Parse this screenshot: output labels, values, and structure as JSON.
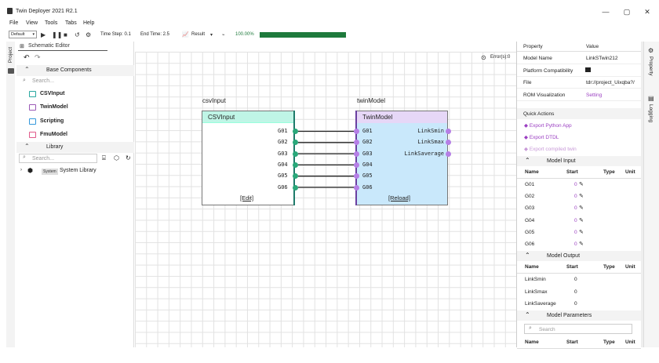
{
  "window": {
    "title": "Twin Deployer 2021 R2.1",
    "minimize": "—",
    "maximize": "▢",
    "close": "✕"
  },
  "menu": [
    "File",
    "View",
    "Tools",
    "Tabs",
    "Help"
  ],
  "toolbar": {
    "mode_select": "Default",
    "time_step": "Time Step: 0.1",
    "end_time": "End Time: 2.5",
    "result_label": "Result",
    "progress_text": "100.00%",
    "progress_value": 1.0
  },
  "left_strip": {
    "project_label": "Project"
  },
  "schematic": {
    "tab_label": "Schematic Editor",
    "errors": "Error(s):0",
    "csv_block": {
      "instance_name": "csvInput",
      "header": "CSVInput",
      "ports": [
        "G01",
        "G02",
        "G03",
        "G04",
        "G05",
        "G06"
      ],
      "action": "[Edit]"
    },
    "twin_block": {
      "instance_name": "twinModel",
      "header": "TwinModel",
      "inputs": [
        "G01",
        "G02",
        "G03",
        "G04",
        "G05",
        "G06"
      ],
      "outputs": [
        "LinkSmin",
        "LinkSmax",
        "LinkSaverage"
      ],
      "action": "[Reload]"
    }
  },
  "base_components": {
    "title": "Base Components",
    "search_placeholder": "Search...",
    "items": [
      {
        "label": "CSVInput",
        "color": "#2aa8a0"
      },
      {
        "label": "TwinModel",
        "color": "#9b59b6"
      },
      {
        "label": "Scripting",
        "color": "#3498db"
      },
      {
        "label": "FmuModel",
        "color": "#e05a8a"
      }
    ]
  },
  "library": {
    "title": "Library",
    "search_placeholder": "Search...",
    "tag": "System",
    "item": "System Library"
  },
  "property_panel": {
    "col_property": "Property",
    "col_value": "Value",
    "rows": [
      {
        "key": "Model Name",
        "value": "LinkSTwin212"
      },
      {
        "key": "Platform Compatibility",
        "value": ""
      },
      {
        "key": "File",
        "value": "tdr://project_Uixqba?/"
      },
      {
        "key": "ROM Visualization",
        "value": "Setting"
      }
    ],
    "quick_actions_title": "Quick Actions",
    "quick_actions": [
      "Export Python App",
      "Export DTDL",
      "Export compiled twin"
    ],
    "model_input": {
      "title": "Model Input",
      "headers": [
        "Name",
        "Start",
        "Type",
        "Unit"
      ],
      "rows": [
        {
          "name": "G01",
          "start": "0"
        },
        {
          "name": "G02",
          "start": "0"
        },
        {
          "name": "G03",
          "start": "0"
        },
        {
          "name": "G04",
          "start": "0"
        },
        {
          "name": "G05",
          "start": "0"
        },
        {
          "name": "G06",
          "start": "0"
        }
      ]
    },
    "model_output": {
      "title": "Model Output",
      "headers": [
        "Name",
        "Start",
        "Type",
        "Unit"
      ],
      "rows": [
        {
          "name": "LinkSmin",
          "start": "0"
        },
        {
          "name": "LinkSmax",
          "start": "0"
        },
        {
          "name": "LinkSaverage",
          "start": "0"
        }
      ]
    },
    "model_parameters": {
      "title": "Model Parameters",
      "search_placeholder": "Search",
      "headers": [
        "Name",
        "Start",
        "Type",
        "Unit"
      ]
    }
  },
  "right_strip": {
    "property_label": "Property",
    "logging_label": "Logging"
  },
  "colors": {
    "csv_header": "#bff5e6",
    "twin_body": "#c9e8fb",
    "twin_header": "#e6d7f7",
    "port_green": "#2aa87a",
    "port_purple": "#b57ee6",
    "link_accent": "#9b3fc2",
    "progress": "#1e7a3c"
  }
}
